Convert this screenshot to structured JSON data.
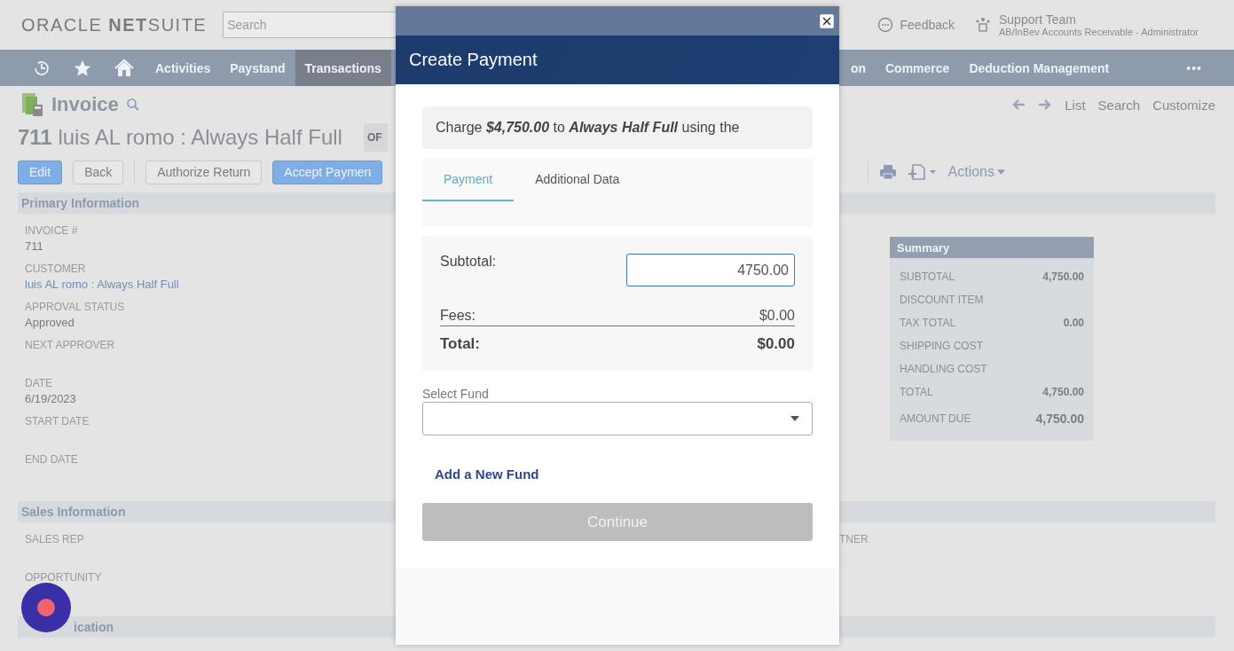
{
  "header": {
    "logo": "ORACLE **NET**SUITE",
    "search_placeholder": "Search",
    "feedback": "Feedback",
    "user_name": "Support Team",
    "user_role": "AB/InBev Accounts Receivable - Administrator"
  },
  "nav": {
    "left_items": [
      {
        "label": "Activities",
        "selected": false
      },
      {
        "label": "Paystand",
        "selected": false
      },
      {
        "label": "Transactions",
        "selected": true
      }
    ],
    "right_items": [
      {
        "label": "on",
        "selected": false
      },
      {
        "label": "Commerce",
        "selected": false
      },
      {
        "label": "Deduction Management",
        "selected": false
      }
    ],
    "more": "•••"
  },
  "record": {
    "type": "Invoice",
    "number": "711",
    "name": "luis AL romo : Always Half Full",
    "status_chip": "OF",
    "links": [
      "List",
      "Search",
      "Customize"
    ],
    "buttons": [
      {
        "label": "Edit",
        "primary": true
      },
      {
        "label": "Back",
        "primary": false
      },
      {
        "label": "Authorize Return",
        "primary": false
      },
      {
        "label": "Accept Paymen",
        "primary": true
      }
    ],
    "actions": "Actions"
  },
  "primary": {
    "title": "Primary Information",
    "fields": [
      {
        "label": "INVOICE #",
        "value": "711",
        "kind": "text"
      },
      {
        "label": "CUSTOMER",
        "value": "luis AL romo : Always Half Full",
        "kind": "link"
      },
      {
        "label": "APPROVAL STATUS",
        "value": "Approved",
        "kind": "text"
      },
      {
        "label": "NEXT APPROVER"
      },
      {
        "label": "DATE",
        "value": "6/19/2023",
        "kind": "text"
      },
      {
        "label": "START DATE"
      },
      {
        "label": "END DATE"
      }
    ]
  },
  "summary": {
    "title": "Summary",
    "rows": [
      {
        "label": "SUBTOTAL",
        "value": "4,750.00"
      },
      {
        "label": "DISCOUNT ITEM"
      },
      {
        "label": "TAX TOTAL",
        "value": "0.00"
      },
      {
        "label": "SHIPPING COST"
      },
      {
        "label": "HANDLING COST"
      },
      {
        "label": "TOTAL",
        "value": "4,750.00"
      },
      {
        "label": "AMOUNT DUE",
        "value": "4,750.00"
      }
    ]
  },
  "sales": {
    "title": "Sales Information",
    "fields": [
      {
        "label": "SALES REP"
      },
      {
        "label": "OPPORTUNITY"
      }
    ],
    "right_label": "TNER"
  },
  "classification": {
    "title": "ication"
  },
  "modal": {
    "title": "Create Payment",
    "charge": "Charge **$4,750.00** to **Always Half Full** using the",
    "tabs": [
      {
        "label": "Payment",
        "selected": true
      },
      {
        "label": "Additional Data",
        "selected": false
      }
    ],
    "subtotal_label": "Subtotal:",
    "subtotal_value": "4750.00",
    "fees_label": "Fees:",
    "fees_value": "$0.00",
    "total_label": "Total:",
    "total_value": "$0.00",
    "fund_label": "Select Fund",
    "add_fund": "Add a New Fund",
    "continue": "Continue",
    "continue_disabled": true
  }
}
